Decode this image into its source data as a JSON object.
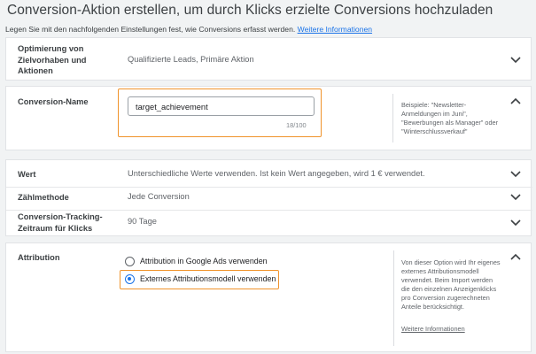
{
  "header": {
    "title": "Conversion-Aktion erstellen, um durch Klicks erzielte Conversions hochzuladen",
    "subtitle": "Legen Sie mit den nachfolgenden Einstellungen fest, wie Conversions erfasst werden.",
    "subtitle_link": "Weitere Informationen"
  },
  "optimierung": {
    "label": "Optimierung von Zielvorhaben und Aktionen",
    "value": "Qualifizierte Leads, Primäre Aktion",
    "icon": "chevron-down-icon"
  },
  "conversion_name": {
    "label": "Conversion-Name",
    "input_value": "target_achievement",
    "counter": "18/100",
    "hint": "Beispiele: \"Newsletter-Anmeldungen im Juni\", \"Bewerbungen als Manager\" oder \"Winterschlussverkauf\"",
    "icon": "chevron-up-icon",
    "highlight_color": "#f0932b"
  },
  "wert": {
    "label": "Wert",
    "value": "Unterschiedliche Werte verwenden. Ist kein Wert angegeben, wird 1 € verwendet.",
    "icon": "chevron-down-icon"
  },
  "zaehlmethode": {
    "label": "Zählmethode",
    "value": "Jede Conversion",
    "icon": "chevron-down-icon"
  },
  "zeitraum": {
    "label": "Conversion-Tracking-Zeitraum für Klicks",
    "value": "90 Tage",
    "icon": "chevron-down-icon"
  },
  "attribution": {
    "label": "Attribution",
    "options": [
      {
        "label": "Attribution in Google Ads verwenden",
        "selected": false
      },
      {
        "label": "Externes Attributionsmodell verwenden",
        "selected": true
      }
    ],
    "hint": "Von dieser Option wird Ihr eigenes externes Attributionsmodell verwendet. Beim Import werden die den einzelnen Anzeigenklicks pro Conversion zugerechneten Anteile berücksichtigt.",
    "hint_link": "Weitere Informationen",
    "icon": "chevron-up-icon"
  },
  "colors": {
    "accent": "#1a73e8",
    "highlight": "#f0932b"
  }
}
